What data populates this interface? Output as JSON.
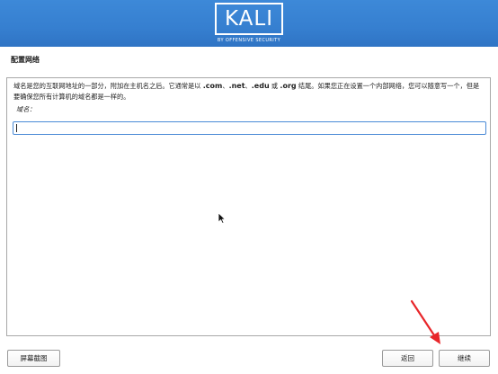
{
  "header": {
    "logo_text": "KALI",
    "logo_subtitle": "BY OFFENSIVE SECURITY"
  },
  "page": {
    "title": "配置网络",
    "description": {
      "part1": "域名是您的互联网地址的一部分，附加在主机名之后。它通常是以 ",
      "com": ".com",
      "sep1": "、",
      "net": ".net",
      "sep2": "、",
      "edu": ".edu",
      "or_word": " 或 ",
      "org": ".org",
      "part2": " 结尾。如果您正在设置一个内部网络，您可以随意写一个，但是要确保您所有计算机的域名都是一样的。"
    },
    "domain_label": "域名：",
    "domain_value": ""
  },
  "buttons": {
    "screenshot": "屏幕截图",
    "back": "返回",
    "continue": "继续"
  },
  "colors": {
    "header_blue": "#367fd0",
    "input_focus": "#4a8ad6",
    "annotation_red": "#e8262a"
  },
  "icons": {
    "pointer": "mouse-pointer-icon",
    "annotation": "red-arrow-icon"
  }
}
